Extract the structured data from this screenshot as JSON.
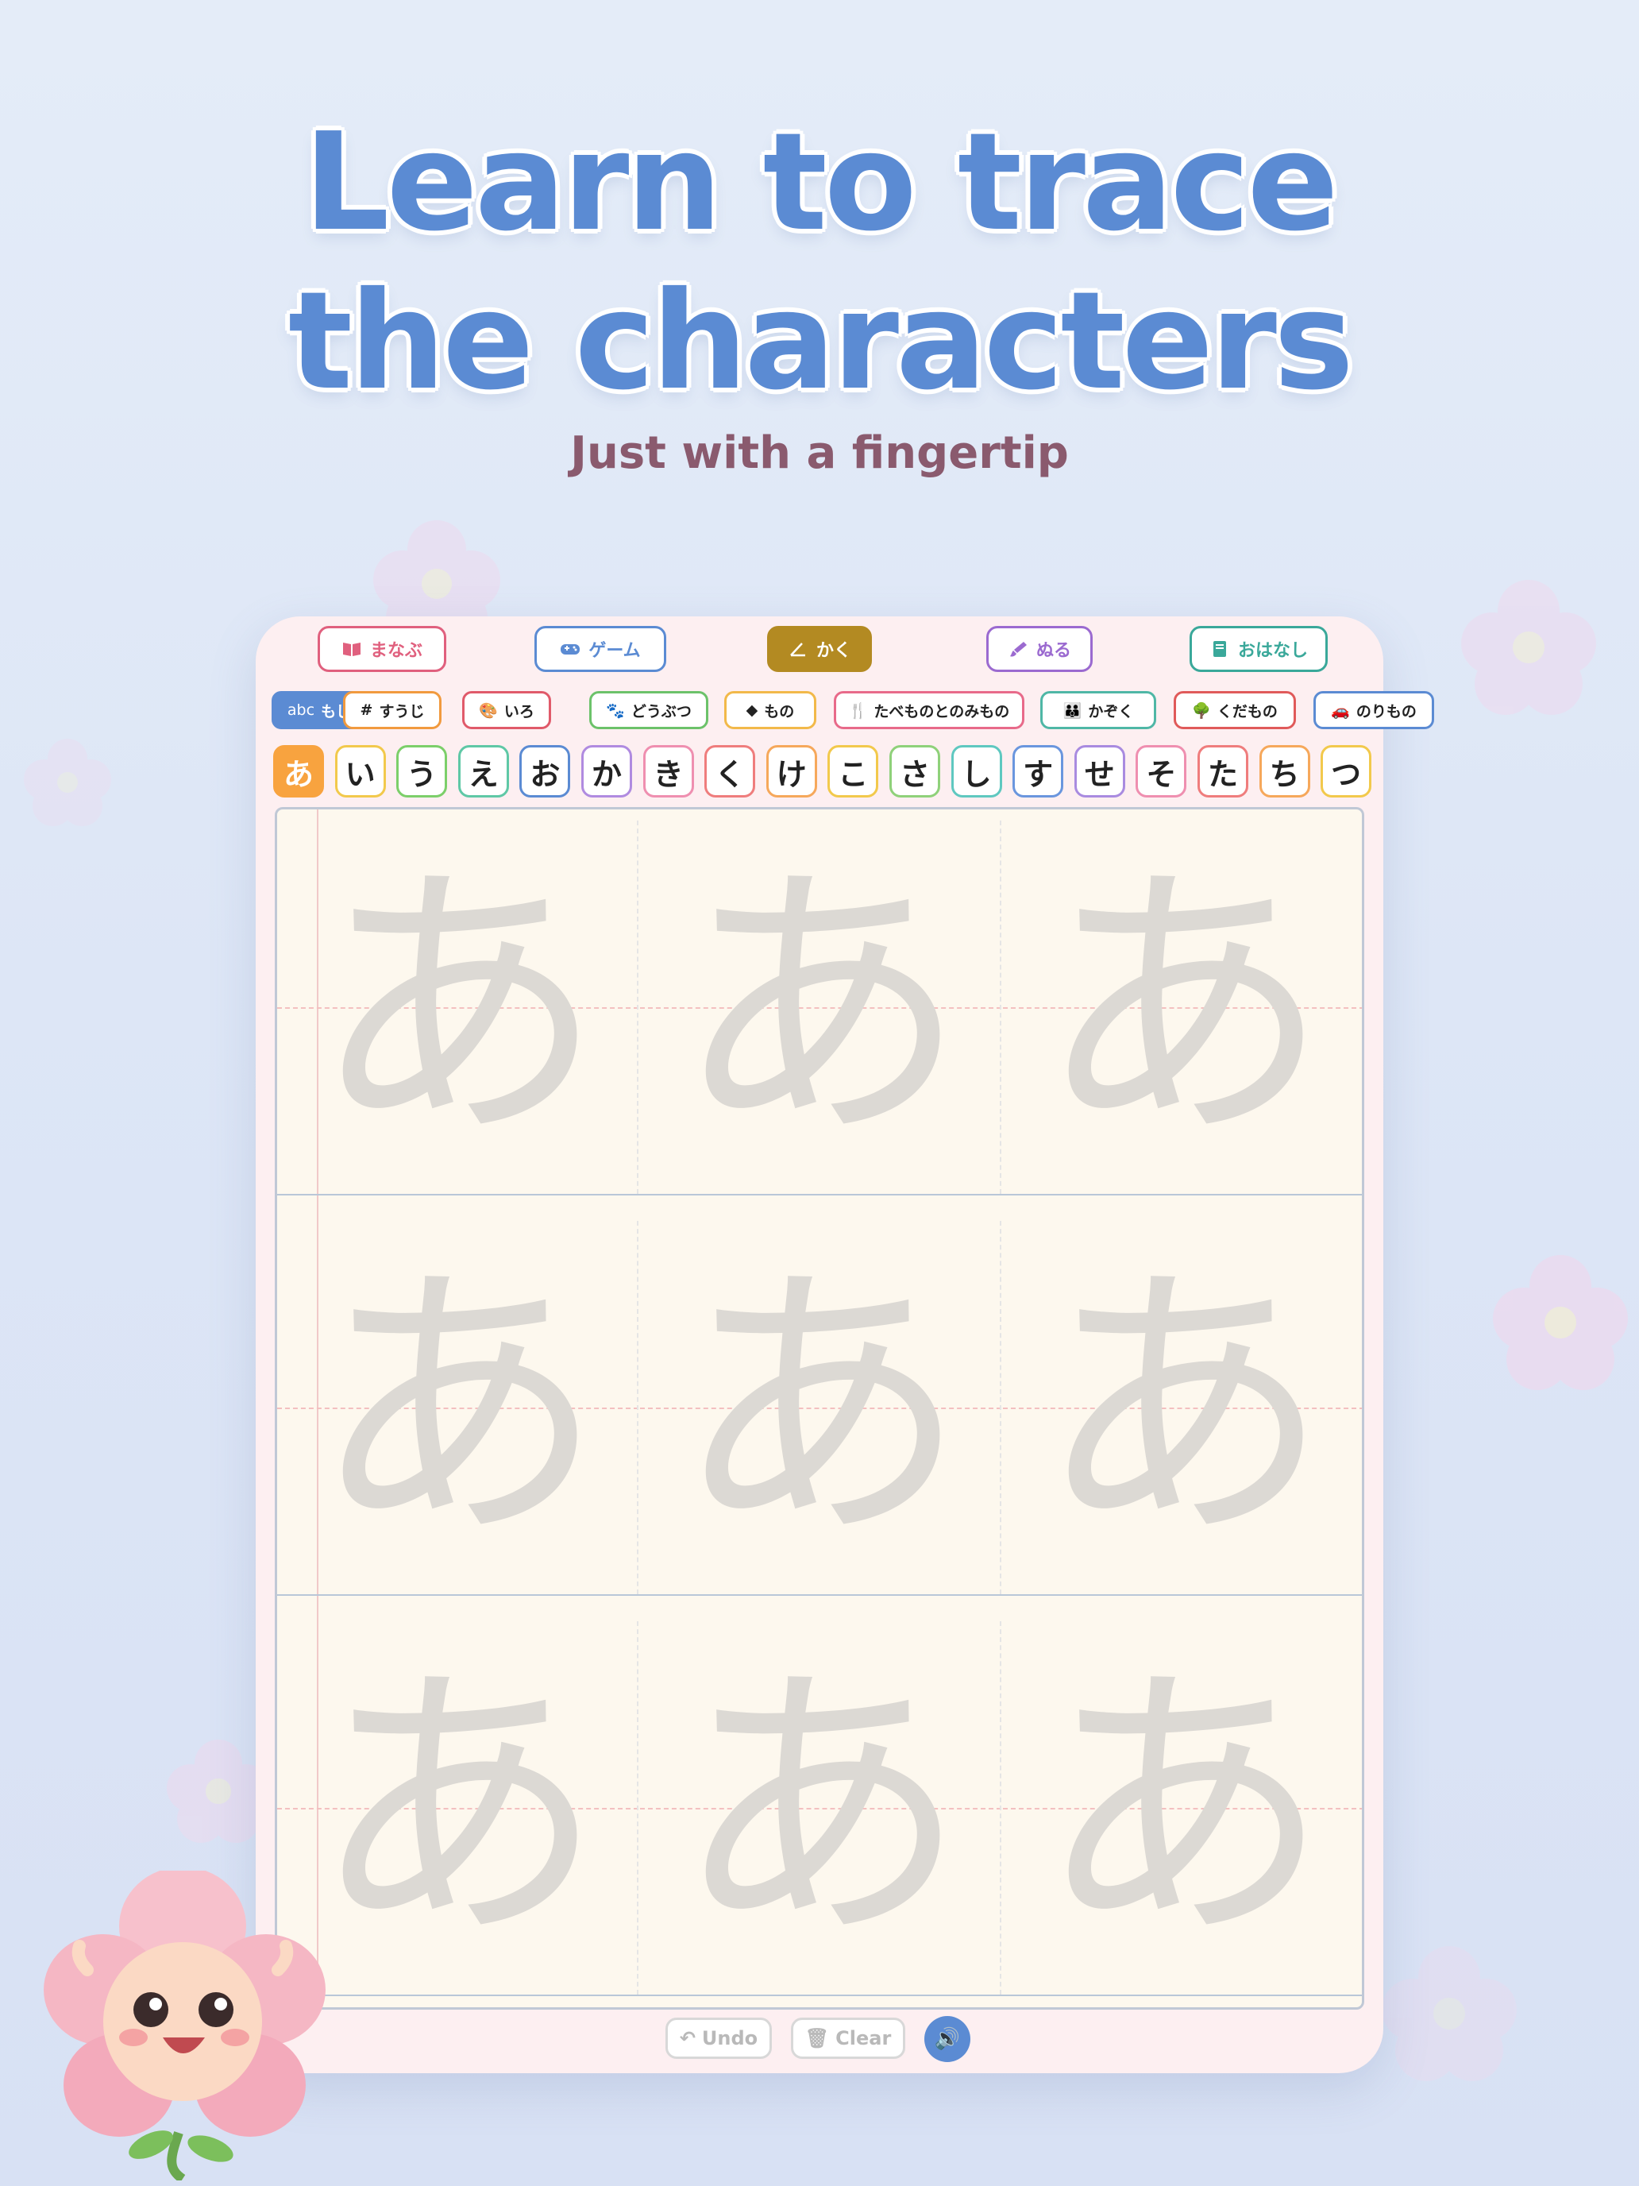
{
  "headline": {
    "line1": "Learn to trace",
    "line2": "the characters"
  },
  "subline": "Just with a fingertip",
  "tabs": [
    {
      "label": "まなぶ",
      "icon": "book-icon",
      "color": "#e0607e",
      "active": false
    },
    {
      "label": "ゲーム",
      "icon": "gamepad-icon",
      "color": "#5b8bd3",
      "active": false
    },
    {
      "label": "かく",
      "icon": "angle-icon",
      "color": "#b38a22",
      "active": true
    },
    {
      "label": "ぬる",
      "icon": "brush-icon",
      "color": "#9b6ad0",
      "active": false
    },
    {
      "label": "おはなし",
      "icon": "storybook-icon",
      "color": "#3aa89a",
      "active": false
    }
  ],
  "categories": [
    {
      "label": "もじ",
      "icon_text": "abc",
      "color": "#5b8bd3",
      "active": true
    },
    {
      "label": "すうじ",
      "icon_text": "#",
      "color": "#f19a3e",
      "active": false
    },
    {
      "label": "いろ",
      "icon_text": "🎨",
      "color": "#e05a6a",
      "active": false
    },
    {
      "label": "どうぶつ",
      "icon_text": "🐾",
      "color": "#6cc26a",
      "active": false
    },
    {
      "label": "もの",
      "icon_text": "◆",
      "color": "#f2b94a",
      "active": false
    },
    {
      "label": "たべものとのみもの",
      "icon_text": "🍴",
      "color": "#e86a8a",
      "active": false
    },
    {
      "label": "かぞく",
      "icon_text": "👪",
      "color": "#4fb7a6",
      "active": false
    },
    {
      "label": "くだもの",
      "icon_text": "🌳",
      "color": "#e05a5a",
      "active": false
    },
    {
      "label": "のりもの",
      "icon_text": "🚗",
      "color": "#5b8bd3",
      "active": false
    }
  ],
  "characters": [
    {
      "char": "あ",
      "color": "#f8a33f",
      "active": true
    },
    {
      "char": "い",
      "color": "#f2c94c",
      "active": false
    },
    {
      "char": "う",
      "color": "#7ccf6a",
      "active": false
    },
    {
      "char": "え",
      "color": "#5fc8a6",
      "active": false
    },
    {
      "char": "お",
      "color": "#5b8bd3",
      "active": false
    },
    {
      "char": "か",
      "color": "#b08be0",
      "active": false
    },
    {
      "char": "き",
      "color": "#ef8fb0",
      "active": false
    },
    {
      "char": "く",
      "color": "#ef7d7d",
      "active": false
    },
    {
      "char": "け",
      "color": "#f6a85b",
      "active": false
    },
    {
      "char": "こ",
      "color": "#f2c94c",
      "active": false
    },
    {
      "char": "さ",
      "color": "#8fd17a",
      "active": false
    },
    {
      "char": "し",
      "color": "#5fc8c0",
      "active": false
    },
    {
      "char": "す",
      "color": "#6a96de",
      "active": false
    },
    {
      "char": "せ",
      "color": "#a98be0",
      "active": false
    },
    {
      "char": "そ",
      "color": "#ef8fb0",
      "active": false
    },
    {
      "char": "た",
      "color": "#ef7d7d",
      "active": false
    },
    {
      "char": "ち",
      "color": "#f6a85b",
      "active": false
    },
    {
      "char": "つ",
      "color": "#f2c94c",
      "active": false
    }
  ],
  "trace_glyph": "あ",
  "controls": {
    "undo": "Undo",
    "clear": "Clear"
  }
}
